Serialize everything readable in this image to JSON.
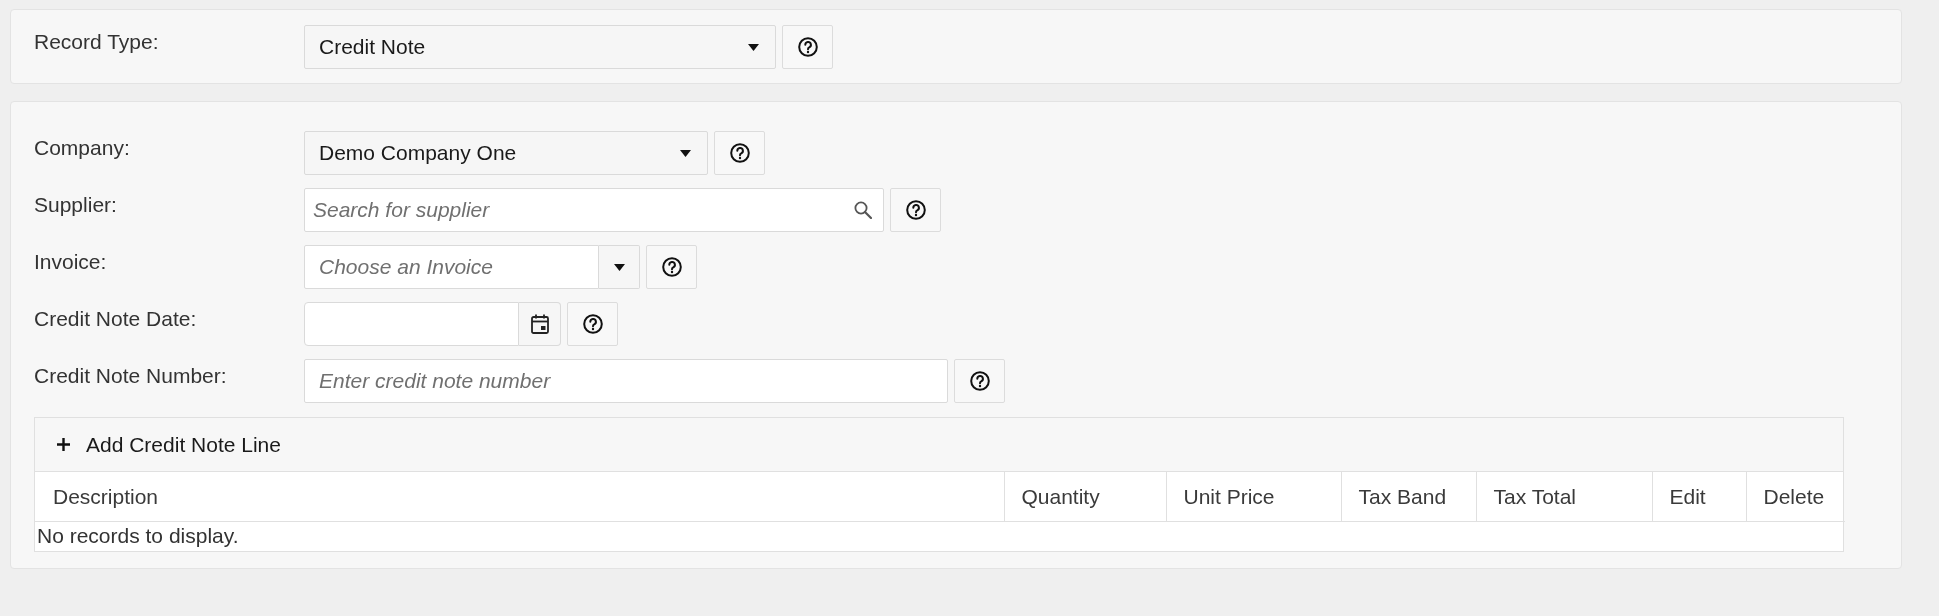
{
  "record_type": {
    "label": "Record Type:",
    "value": "Credit Note"
  },
  "form": {
    "fields": [
      {
        "kind": "select",
        "label": "Company:",
        "value": "Demo Company One"
      },
      {
        "kind": "search",
        "label": "Supplier:",
        "placeholder": "Search for supplier"
      },
      {
        "kind": "combo",
        "label": "Invoice:",
        "placeholder": "Choose an Invoice"
      },
      {
        "kind": "date",
        "label": "Credit Note Date:"
      },
      {
        "kind": "text",
        "label": "Credit Note Number:",
        "placeholder": "Enter credit note number"
      }
    ]
  },
  "grid": {
    "toolbar_button": "Add Credit Note Line",
    "columns": [
      "Description",
      "Quantity",
      "Unit Price",
      "Tax Band",
      "Tax Total",
      "Edit",
      "Delete"
    ],
    "empty_message": "No records to display."
  }
}
